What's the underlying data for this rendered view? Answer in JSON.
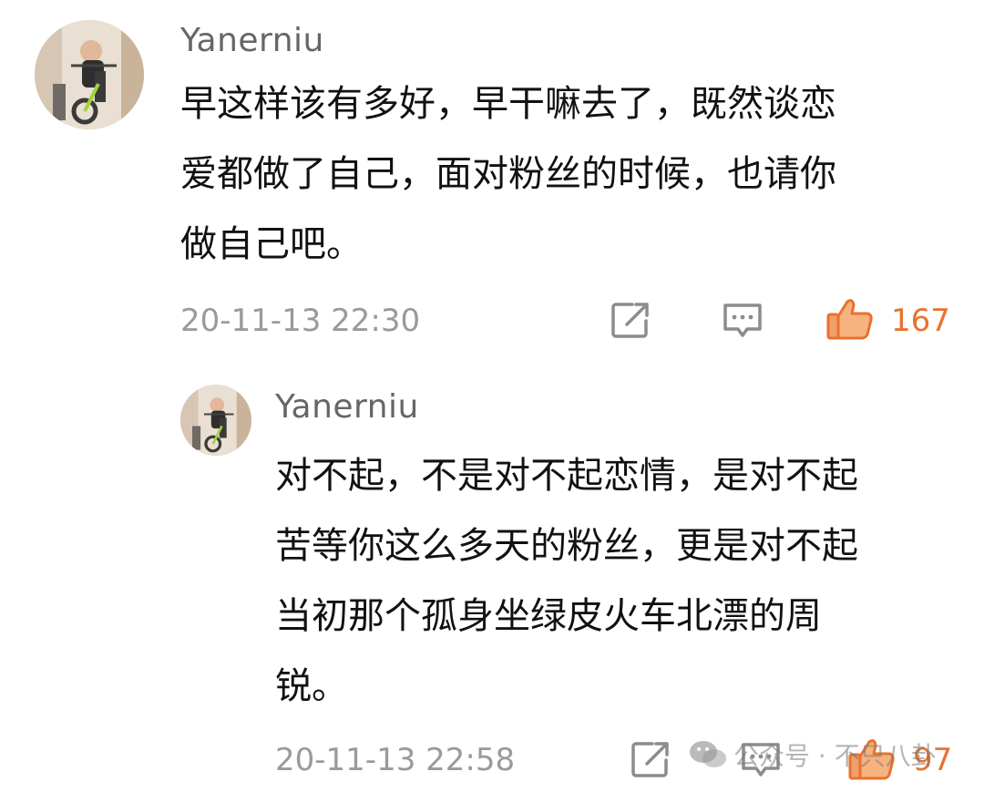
{
  "colors": {
    "accent": "#e8722e",
    "meta": "#9a9a9a",
    "icon": "#8c8c8c"
  },
  "comments": [
    {
      "username": "Yanerniu",
      "lines": [
        "早这样该有多好，早干嘛去了，既然谈恋",
        "爱都做了自己，面对粉丝的时候，也请你",
        "做自己吧。"
      ],
      "timestamp": "20-11-13 22:30",
      "likes": "167",
      "icons": [
        "share-icon",
        "reply-icon",
        "thumbs-up-icon"
      ]
    },
    {
      "username": "Yanerniu",
      "lines": [
        "对不起，不是对不起恋情，是对不起",
        "苦等你这么多天的粉丝，更是对不起",
        "当初那个孤身坐绿皮火车北漂的周",
        "锐。"
      ],
      "timestamp": "20-11-13 22:58",
      "likes": "97",
      "icons": [
        "share-icon",
        "reply-icon",
        "thumbs-up-icon"
      ]
    }
  ],
  "watermark": {
    "text": "公众号 · 不只八卦",
    "icon": "wechat-icon"
  }
}
